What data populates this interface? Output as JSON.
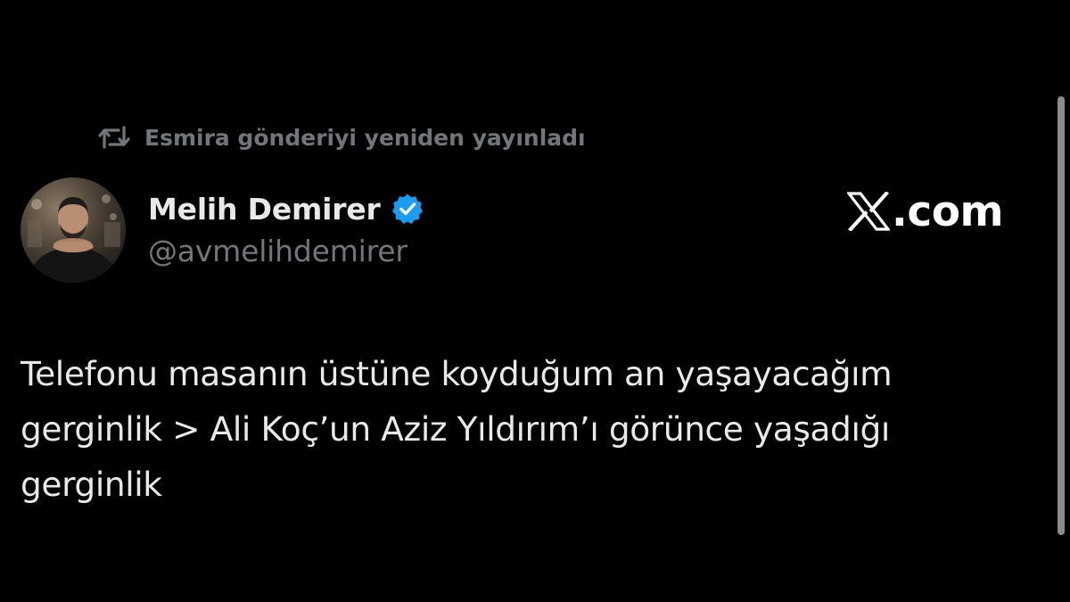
{
  "repost": {
    "icon": "repost-icon",
    "text": "Esmira gönderiyi yeniden yayınladı"
  },
  "author": {
    "avatar": "avatar",
    "name": "Melih Demirer",
    "verified_icon": "verified-badge-icon",
    "handle": "@avmelihdemirer"
  },
  "brand": {
    "icon": "x-logo-icon",
    "text": ".com"
  },
  "tweet": {
    "lines": [
      "Telefonu masanın üstüne koyduğum an yaşayacağım",
      "gerginlik > Ali Koç’un Aziz Yıldırım’ı görünce yaşadığı",
      "gerginlik"
    ]
  },
  "colors": {
    "background": "#000000",
    "text_primary": "#e7e9ea",
    "text_secondary": "#71767b",
    "verified_blue": "#1d9bf0",
    "scrollbar": "#8a8a8a"
  }
}
